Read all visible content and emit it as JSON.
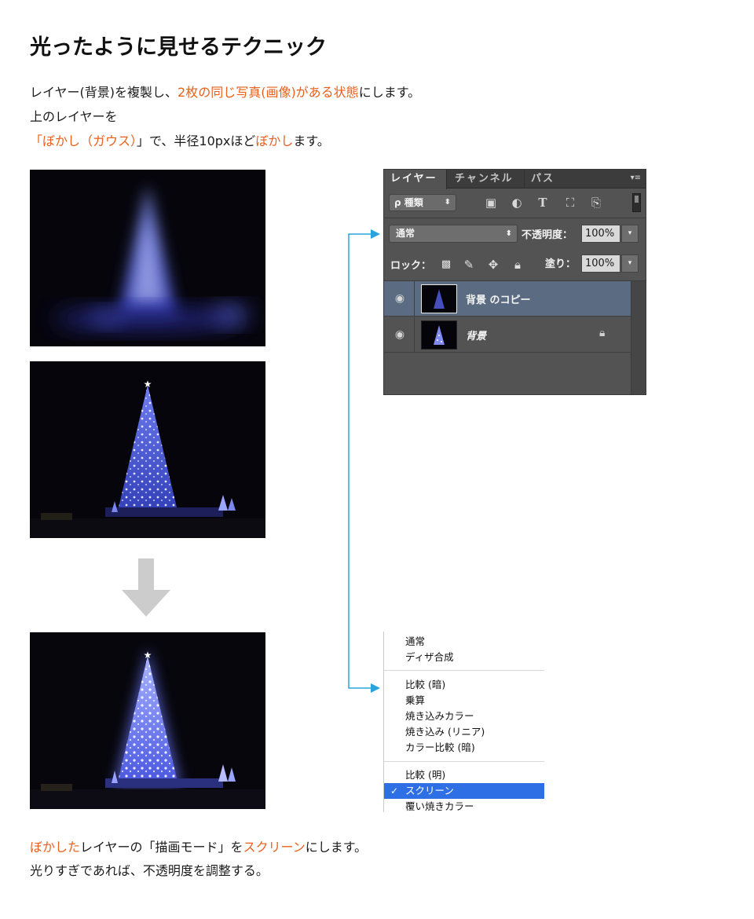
{
  "title": "光ったように見せるテクニック",
  "intro": {
    "line1_a": "レイヤー(背景)を複製し、",
    "line1_b": "2枚の同じ写真(画像)がある状態",
    "line1_c": "にします。",
    "line2": "上のレイヤーを",
    "line3_a": "「",
    "line3_b": "ぼかし（ガウス）",
    "line3_c": "」で、半径10pxほど",
    "line3_d": "ぼかし",
    "line3_e": "ます。"
  },
  "panel": {
    "tabs": [
      "レイヤー",
      "チャンネル",
      "パス"
    ],
    "menu_glyph": "▾≡",
    "kind_label": "ρ 種類",
    "kind_arrow": "⬍",
    "blend_mode": "通常",
    "blend_arrow": "⬍",
    "opacity_label": "不透明度：",
    "opacity_value": "100%",
    "lock_label": "ロック：",
    "fill_label": "塗り：",
    "fill_value": "100%",
    "dropdown_arrow": "▾",
    "layers": [
      {
        "name": "背景 のコピー",
        "selected": true
      },
      {
        "name": "背景",
        "selected": false
      }
    ]
  },
  "blend_menu": {
    "group1": [
      "通常",
      "ディザ合成"
    ],
    "group2": [
      "比較 (暗)",
      "乗算",
      "焼き込みカラー",
      "焼き込み (リニア)",
      "カラー比較 (暗)"
    ],
    "group3": [
      "比較 (明)",
      "スクリーン",
      "覆い焼きカラー"
    ],
    "selected_item": "スクリーン",
    "check": "✓"
  },
  "outro": {
    "line1_a": "ぼかした",
    "line1_b": "レイヤーの「描画モード」を",
    "line1_c": "スクリーン",
    "line1_d": "にします。",
    "line2": "光りすぎであれば、不透明度を調整する。"
  },
  "colors": {
    "highlight": "#e8601c",
    "connector": "#29a3dd",
    "menu_selection": "#2f6fe5",
    "panel_bg": "#535353"
  },
  "icons": [
    "filter-image-icon",
    "filter-adjustment-icon",
    "filter-type-icon",
    "filter-shape-icon",
    "filter-smartobject-icon",
    "lock-transparent-icon",
    "lock-paint-icon",
    "lock-move-icon",
    "lock-all-icon",
    "eye-icon",
    "padlock-icon",
    "down-arrow-icon"
  ]
}
